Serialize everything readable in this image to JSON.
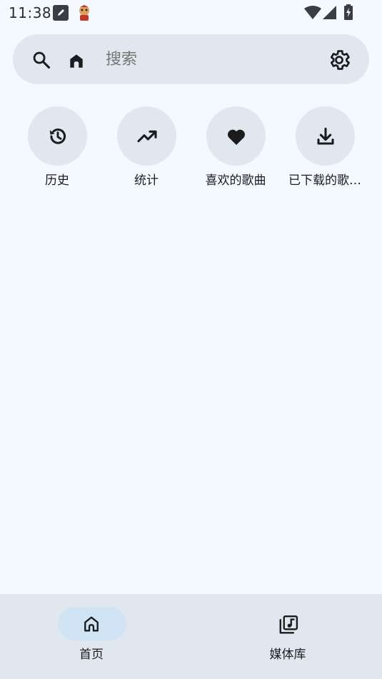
{
  "status_bar": {
    "time": "11:38"
  },
  "search": {
    "placeholder": "搜索"
  },
  "shortcuts": [
    {
      "label": "历史",
      "icon": "history-icon"
    },
    {
      "label": "统计",
      "icon": "trending-up-icon"
    },
    {
      "label": "喜欢的歌曲",
      "icon": "heart-icon"
    },
    {
      "label": "已下载的歌…",
      "icon": "download-icon"
    }
  ],
  "bottom_nav": {
    "items": [
      {
        "label": "首页",
        "icon": "home-icon",
        "selected": true
      },
      {
        "label": "媒体库",
        "icon": "library-music-icon",
        "selected": false
      }
    ]
  },
  "colors": {
    "background": "#f3f9ff",
    "surface": "#e1e7ee",
    "selected_pill": "#d0e4f6",
    "icon": "#1a1c1e"
  }
}
